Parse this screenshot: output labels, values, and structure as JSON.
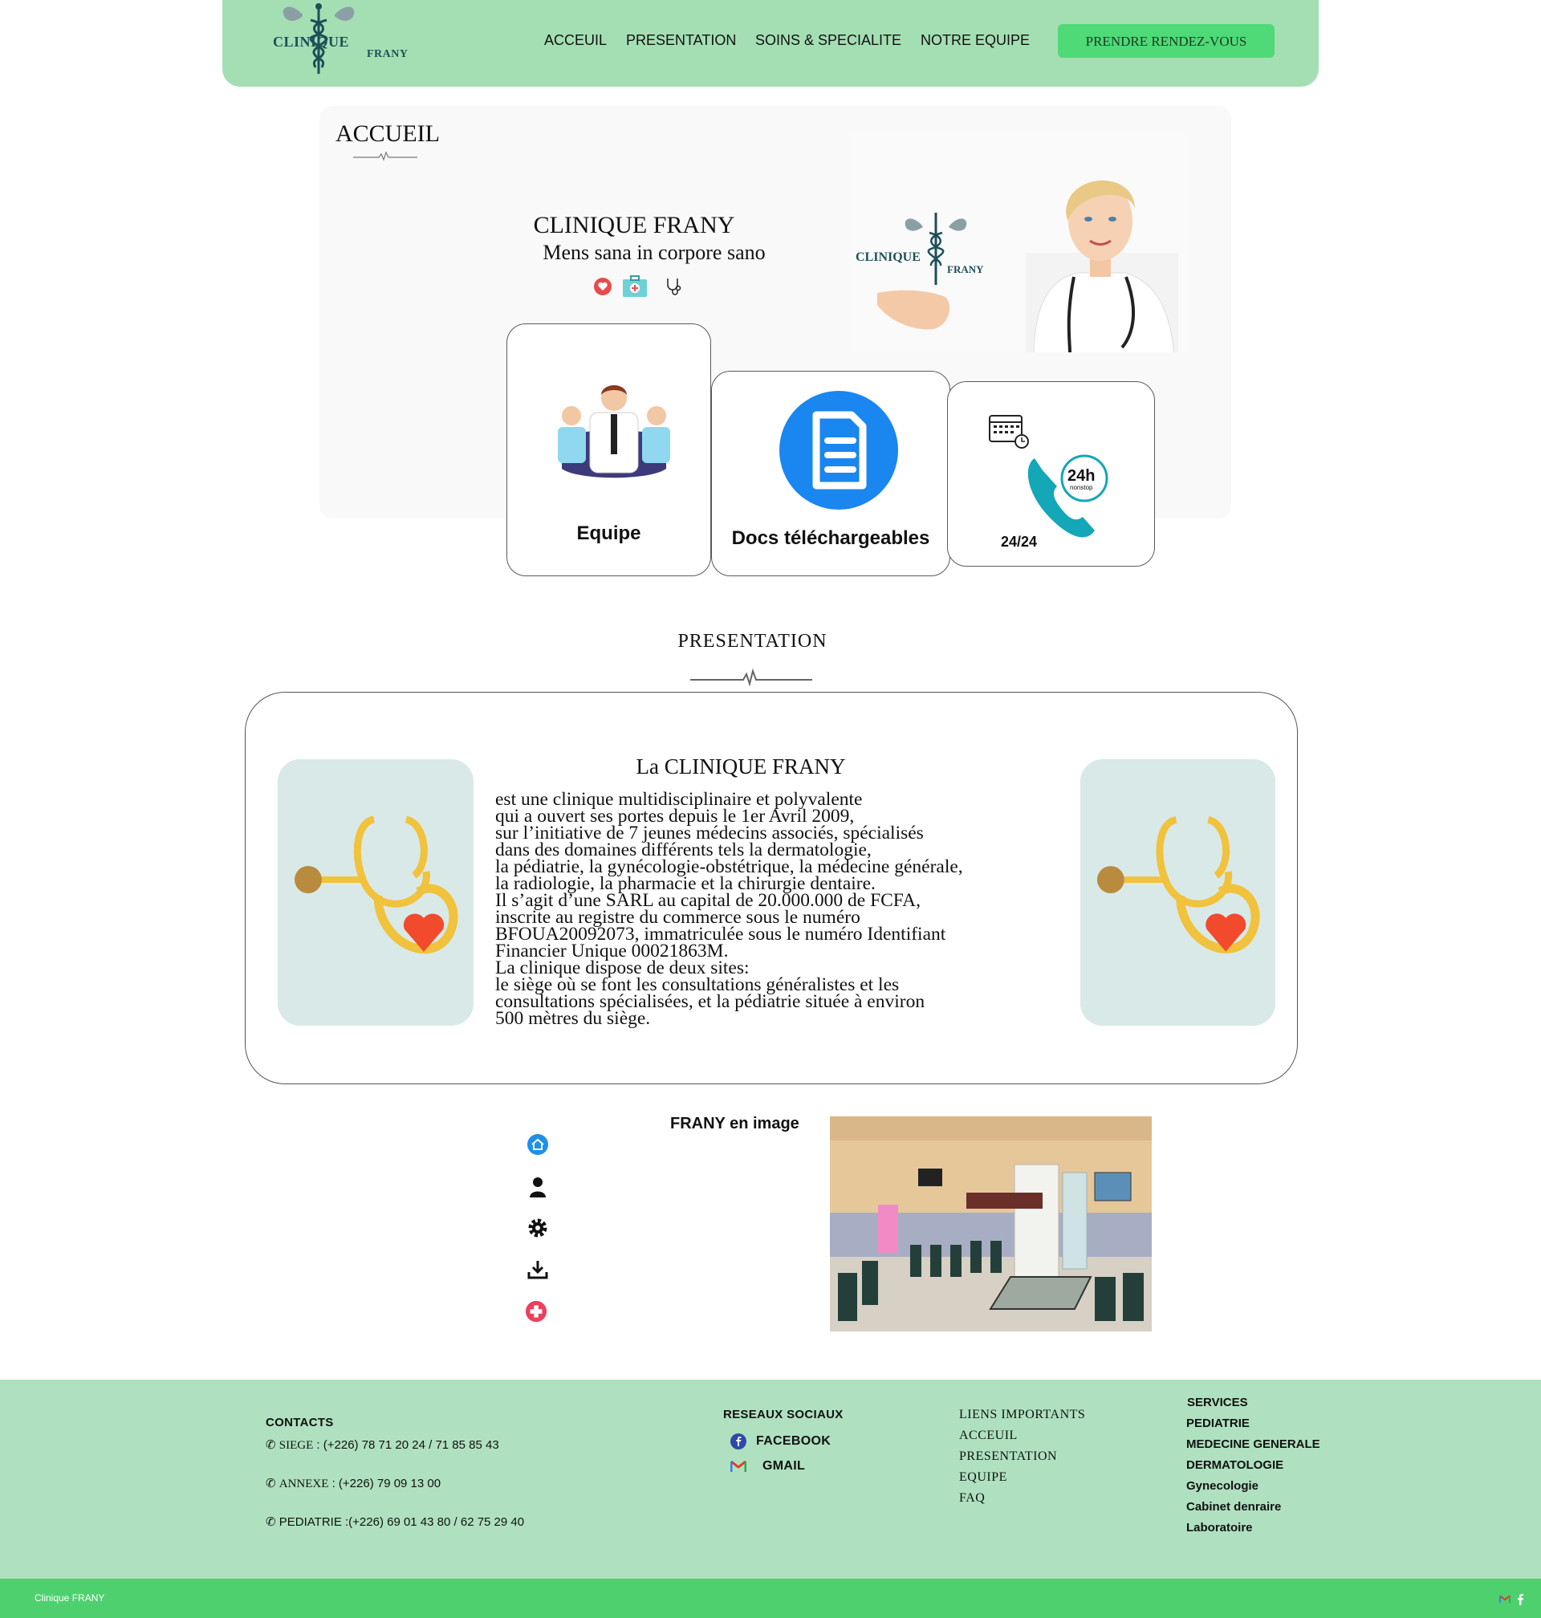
{
  "header": {
    "logo_line1": "CLINIQUE",
    "logo_line2": "FRANY",
    "nav": [
      "ACCEUIL",
      "PRESENTATION",
      "SOINS & SPECIALITE",
      "NOTRE EQUIPE"
    ],
    "cta_label": "PRENDRE RENDEZ-VOUS"
  },
  "hero": {
    "section_title": "ACCUEIL",
    "name": "CLINIQUE FRANY",
    "motto": "Mens sana in corpore sano",
    "image_logo_line1": "CLINIQUE",
    "image_logo_line2": "FRANY",
    "icons": [
      "heart-icon",
      "medical-kit-icon",
      "stethoscope-icon"
    ]
  },
  "cards": [
    {
      "label": "Equipe",
      "icon": "team-icon"
    },
    {
      "label": "Docs téléchargeables",
      "icon": "document-icon"
    },
    {
      "label": "24/24",
      "icon": "phone-24h-icon",
      "badge_top": "24h",
      "badge_bottom": "nonstop"
    }
  ],
  "presentation": {
    "title": "PRESENTATION",
    "heading": "La CLINIQUE FRANY",
    "text": "   est une clinique multidisciplinaire et polyvalente\nqui a ouvert ses portes depuis le 1er Avril 2009,\nsur l’initiative de 7 jeunes médecins associés, spécialisés\ndans des domaines différents tels la dermatologie,\nla pédiatrie, la gynécologie-obstétrique, la médecine générale,\nla radiologie, la pharmacie et la chirurgie dentaire.\nIl s’agit d’une SARL au capital de 20.000.000 de FCFA,\ninscrite au registre du commerce sous le numéro\nBFOUA20092073, immatriculée sous le numéro Identifiant\nFinancier Unique 00021863M.\nLa clinique dispose de deux sites:\nle siège où se font les consultations généralistes et les\nconsultations spécialisées, et la pédiatrie située à environ\n500 mètres du siège."
  },
  "gallery": {
    "title": "FRANY en image",
    "side_icons": [
      "home-icon",
      "user-icon",
      "gear-icon",
      "download-icon",
      "medical-cross-icon"
    ]
  },
  "footer": {
    "contacts_title": "CONTACTS",
    "contacts": [
      {
        "label": "SIEGE",
        "value": " : (+226) 78 71 20 24 / 71 85 85 43"
      },
      {
        "label": "ANNEXE",
        "value": " : (+226) 79 09 13 00"
      },
      {
        "label": "PEDIATRIE",
        "value": " :(+226) 69 01 43 80 / 62 75 29 40"
      }
    ],
    "social_title": "RESEAUX SOCIAUX",
    "social": [
      {
        "label": "FACEBOOK",
        "icon": "facebook-icon"
      },
      {
        "label": "GMAIL",
        "icon": "gmail-icon"
      }
    ],
    "links_title": "LIENS IMPORTANTS",
    "links": [
      "ACCEUIL",
      "PRESENTATION",
      "EQUIPE",
      "FAQ"
    ],
    "services_title": "SERVICES",
    "services": [
      "PEDIATRIE",
      "MEDECINE GENERALE",
      "DERMATOLOGIE",
      "Gynecologie",
      "Cabinet denraire",
      "Laboratoire"
    ]
  },
  "bottom_bar": {
    "text": "Clinique FRANY",
    "icons": [
      "gmail-icon",
      "facebook-icon"
    ]
  },
  "colors": {
    "header_bg": "#a4dfb3",
    "cta_bg": "#4fd977",
    "footer_bg": "#afe1c0",
    "bottom_bar_bg": "#4fd06f",
    "doc_icon_blue": "#1a86f0"
  }
}
